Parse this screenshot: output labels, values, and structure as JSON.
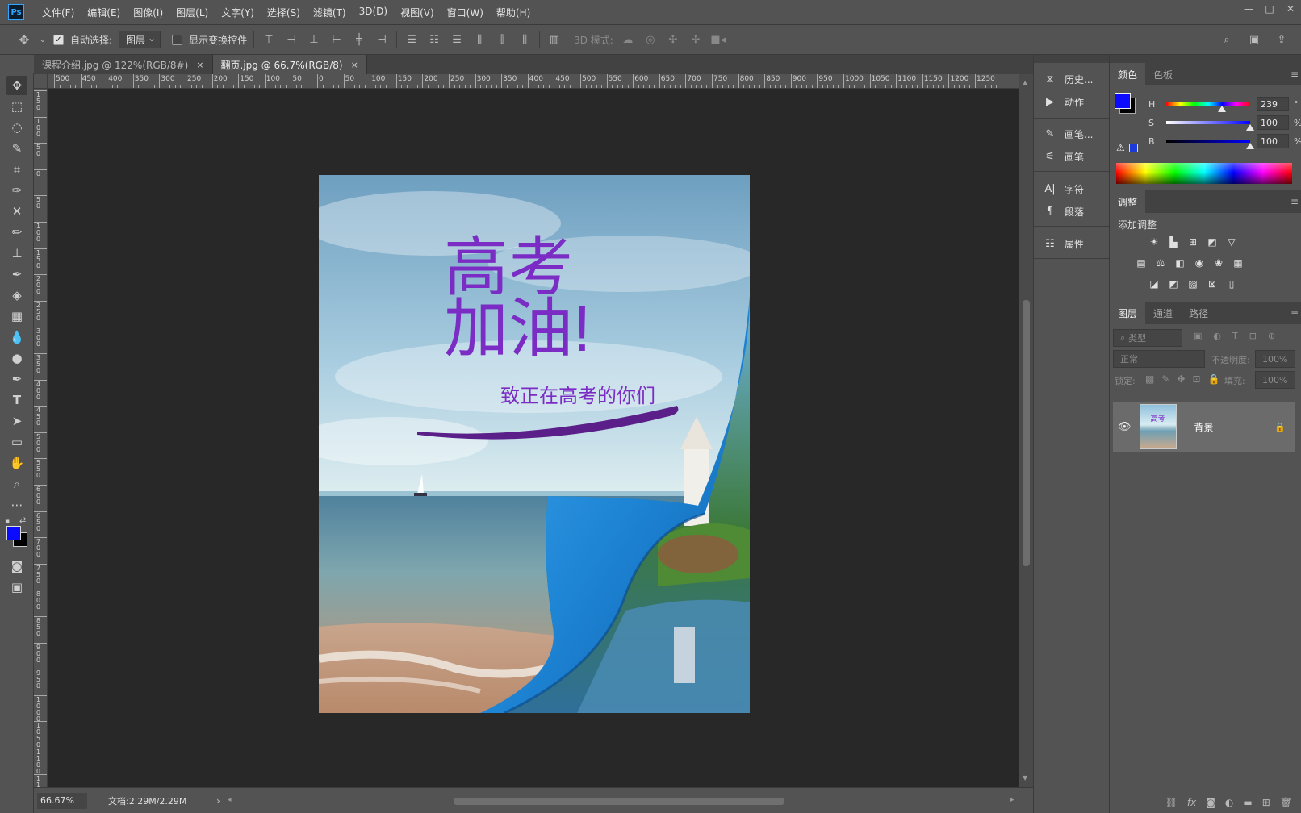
{
  "app": {
    "logo": "Ps"
  },
  "menu": [
    "文件(F)",
    "编辑(E)",
    "图像(I)",
    "图层(L)",
    "文字(Y)",
    "选择(S)",
    "滤镜(T)",
    "3D(D)",
    "视图(V)",
    "窗口(W)",
    "帮助(H)"
  ],
  "window_controls": {
    "minimize": "—",
    "maximize": "□",
    "close": "✕"
  },
  "options": {
    "auto_select_label": "自动选择:",
    "auto_select_value": "图层",
    "show_transform_label": "显示变换控件",
    "mode_3d_label": "3D 模式:"
  },
  "tabs": [
    {
      "label": "课程介绍.jpg @ 122%(RGB/8#)",
      "close": "×",
      "active": false
    },
    {
      "label": "翻页.jpg @ 66.7%(RGB/8)",
      "close": "×",
      "active": true
    }
  ],
  "ruler_h_labels": [
    "500",
    "450",
    "400",
    "350",
    "300",
    "250",
    "200",
    "150",
    "100",
    "50",
    "0",
    "50",
    "100",
    "150",
    "200",
    "250",
    "300",
    "350",
    "400",
    "450",
    "500",
    "550",
    "600",
    "650",
    "700",
    "750",
    "800",
    "850",
    "900",
    "950",
    "1000",
    "1050",
    "1100",
    "1150",
    "1200",
    "1250"
  ],
  "ruler_v_labels": [
    "150",
    "100",
    "50",
    "0",
    "50",
    "100",
    "150",
    "200",
    "250",
    "300",
    "350",
    "400",
    "450",
    "500",
    "550",
    "600",
    "650",
    "700",
    "750",
    "800",
    "850",
    "900",
    "950",
    "1000",
    "1050",
    "1100",
    "1150"
  ],
  "document": {
    "headline_1": "高考",
    "headline_2": "加油!",
    "subtitle": "致正在高考的你们",
    "text_color": "#7b2cc4"
  },
  "status": {
    "zoom": "66.67%",
    "doc_info": "文档:2.29M/2.29M",
    "arrow": "›"
  },
  "mid_panel": [
    {
      "icon": "history-icon",
      "label": "历史..."
    },
    {
      "icon": "actions-icon",
      "label": "动作"
    },
    {
      "icon": "brush-settings-icon",
      "label": "画笔..."
    },
    {
      "icon": "brushes-icon",
      "label": "画笔"
    },
    {
      "icon": "character-icon",
      "label": "字符"
    },
    {
      "icon": "paragraph-icon",
      "label": "段落"
    },
    {
      "icon": "properties-icon",
      "label": "属性"
    }
  ],
  "color_panel": {
    "tabs": [
      "颜色",
      "色板"
    ],
    "h_label": "H",
    "h_value": "239",
    "h_unit": "°",
    "h_fraction": 0.664,
    "s_label": "S",
    "s_value": "100",
    "s_unit": "%",
    "s_fraction": 1.0,
    "b_label": "B",
    "b_value": "100",
    "b_unit": "%",
    "b_fraction": 1.0,
    "foreground": "#0b0bff",
    "background": "#000000"
  },
  "adjust_panel": {
    "tab": "调整",
    "title": "添加调整"
  },
  "layers_panel": {
    "tabs": [
      "图层",
      "通道",
      "路径"
    ],
    "filter_placeholder": "类型",
    "blend_mode": "正常",
    "opacity_label": "不透明度:",
    "opacity_value": "100%",
    "lock_label": "锁定:",
    "fill_label": "填充:",
    "fill_value": "100%",
    "layers": [
      {
        "name": "背景",
        "visible": true,
        "locked": true,
        "thumb_text": "高考"
      }
    ]
  }
}
